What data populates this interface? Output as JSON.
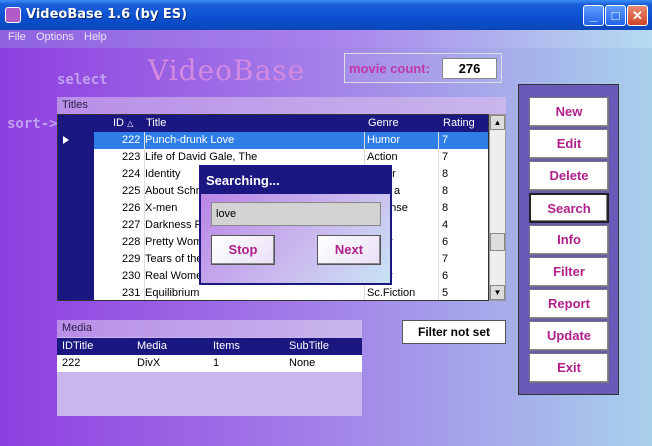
{
  "window": {
    "title": "VideoBase 1.6 (by ES)"
  },
  "menu": [
    "File",
    "Options",
    "Help"
  ],
  "logo": "VideoBase",
  "labels": {
    "select": "select",
    "sort": "sort->"
  },
  "movie_count": {
    "label": "movie count:",
    "value": "276"
  },
  "titles": {
    "header": "Titles",
    "columns": {
      "id": "ID",
      "title": "Title",
      "genre": "Genre",
      "rating": "Rating"
    },
    "rows": [
      {
        "id": "222",
        "title": "Punch-drunk Love",
        "genre": "Humor",
        "rating": "7",
        "selected": true
      },
      {
        "id": "223",
        "title": "Life of David Gale, The",
        "genre": "Action",
        "rating": "7"
      },
      {
        "id": "224",
        "title": "Identity",
        "genre": "er",
        "rating": "8"
      },
      {
        "id": "225",
        "title": "About Schm",
        "genre": "a",
        "rating": "8"
      },
      {
        "id": "226",
        "title": "X-men",
        "genre": "ense",
        "rating": "8"
      },
      {
        "id": "227",
        "title": "Darkness F",
        "genre": "",
        "rating": "4"
      },
      {
        "id": "228",
        "title": "Pretty Wom",
        "genre": "r",
        "rating": "6"
      },
      {
        "id": "229",
        "title": "Tears of the",
        "genre": "",
        "rating": "7"
      },
      {
        "id": "230",
        "title": "Real Wome",
        "genre": "r",
        "rating": "6"
      },
      {
        "id": "231",
        "title": "Equilibrium",
        "genre": "Sc.Fiction",
        "rating": "5"
      }
    ]
  },
  "buttons": [
    "New",
    "Edit",
    "Delete",
    "Search",
    "Info",
    "Filter",
    "Report",
    "Update",
    "Exit"
  ],
  "media": {
    "header": "Media",
    "columns": [
      "IDTitle",
      "Media",
      "Items",
      "SubTitle"
    ],
    "row": [
      "222",
      "DivX",
      "1",
      "None"
    ]
  },
  "filter_status": "Filter not set",
  "search_dialog": {
    "title": "Searching...",
    "input_value": "love",
    "stop": "Stop",
    "next": "Next"
  }
}
